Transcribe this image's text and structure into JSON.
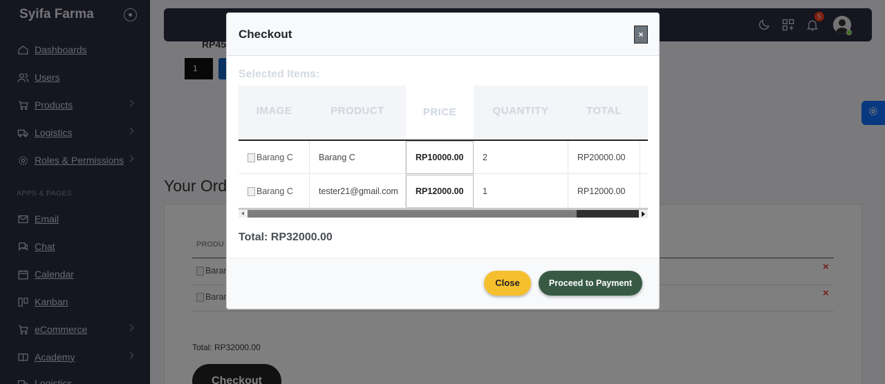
{
  "sidebar": {
    "brand": "Syifa Farma",
    "section_header": "APPS & PAGES",
    "items": [
      {
        "label": "Dashboards",
        "icon": "home-icon"
      },
      {
        "label": "Users",
        "icon": "users-icon"
      },
      {
        "label": "Products",
        "icon": "cart-icon"
      },
      {
        "label": "Logistics",
        "icon": "truck-icon"
      },
      {
        "label": "Roles & Permissions",
        "icon": "gear-icon"
      },
      {
        "label": "Email",
        "icon": "mail-icon"
      },
      {
        "label": "Chat",
        "icon": "chat-icon"
      },
      {
        "label": "Calendar",
        "icon": "calendar-icon"
      },
      {
        "label": "Kanban",
        "icon": "kanban-icon"
      },
      {
        "label": "eCommerce",
        "icon": "cart-icon"
      },
      {
        "label": "Academy",
        "icon": "book-icon"
      },
      {
        "label": "Logistics",
        "icon": "truck-icon"
      }
    ]
  },
  "topbar": {
    "notification_count": "5"
  },
  "background": {
    "price_peek": "RP45",
    "qty_value": "1",
    "orders_title": "Your Ord",
    "orders_column": "PRODU",
    "orders_img_alt_1": "Baran",
    "orders_img_alt_2": "Baran",
    "remove_symbol": "×",
    "total_text": "Total: RP32000.00",
    "checkout_button": "Checkout"
  },
  "modal": {
    "title": "Checkout",
    "close_symbol": "×",
    "selected_label": "Selected Items:",
    "columns": [
      "IMAGE",
      "PRODUCT",
      "PRICE",
      "QUANTITY",
      "TOTAL"
    ],
    "rows": [
      {
        "image_alt": "Barang C",
        "product": "Barang C",
        "price": "RP10000.00",
        "quantity": "2",
        "total": "RP20000.00"
      },
      {
        "image_alt": "Barang C",
        "product": "tester21@gmail.com",
        "price": "RP12000.00",
        "quantity": "1",
        "total": "RP12000.00"
      }
    ],
    "total": "Total: RP32000.00",
    "close_button": "Close",
    "proceed_button": "Proceed to Payment"
  },
  "colors": {
    "sidebar_bg": "#2b2c40",
    "close_button": "#f6bf2e",
    "proceed_button": "#385a45",
    "settings_fab": "#1170ff"
  }
}
